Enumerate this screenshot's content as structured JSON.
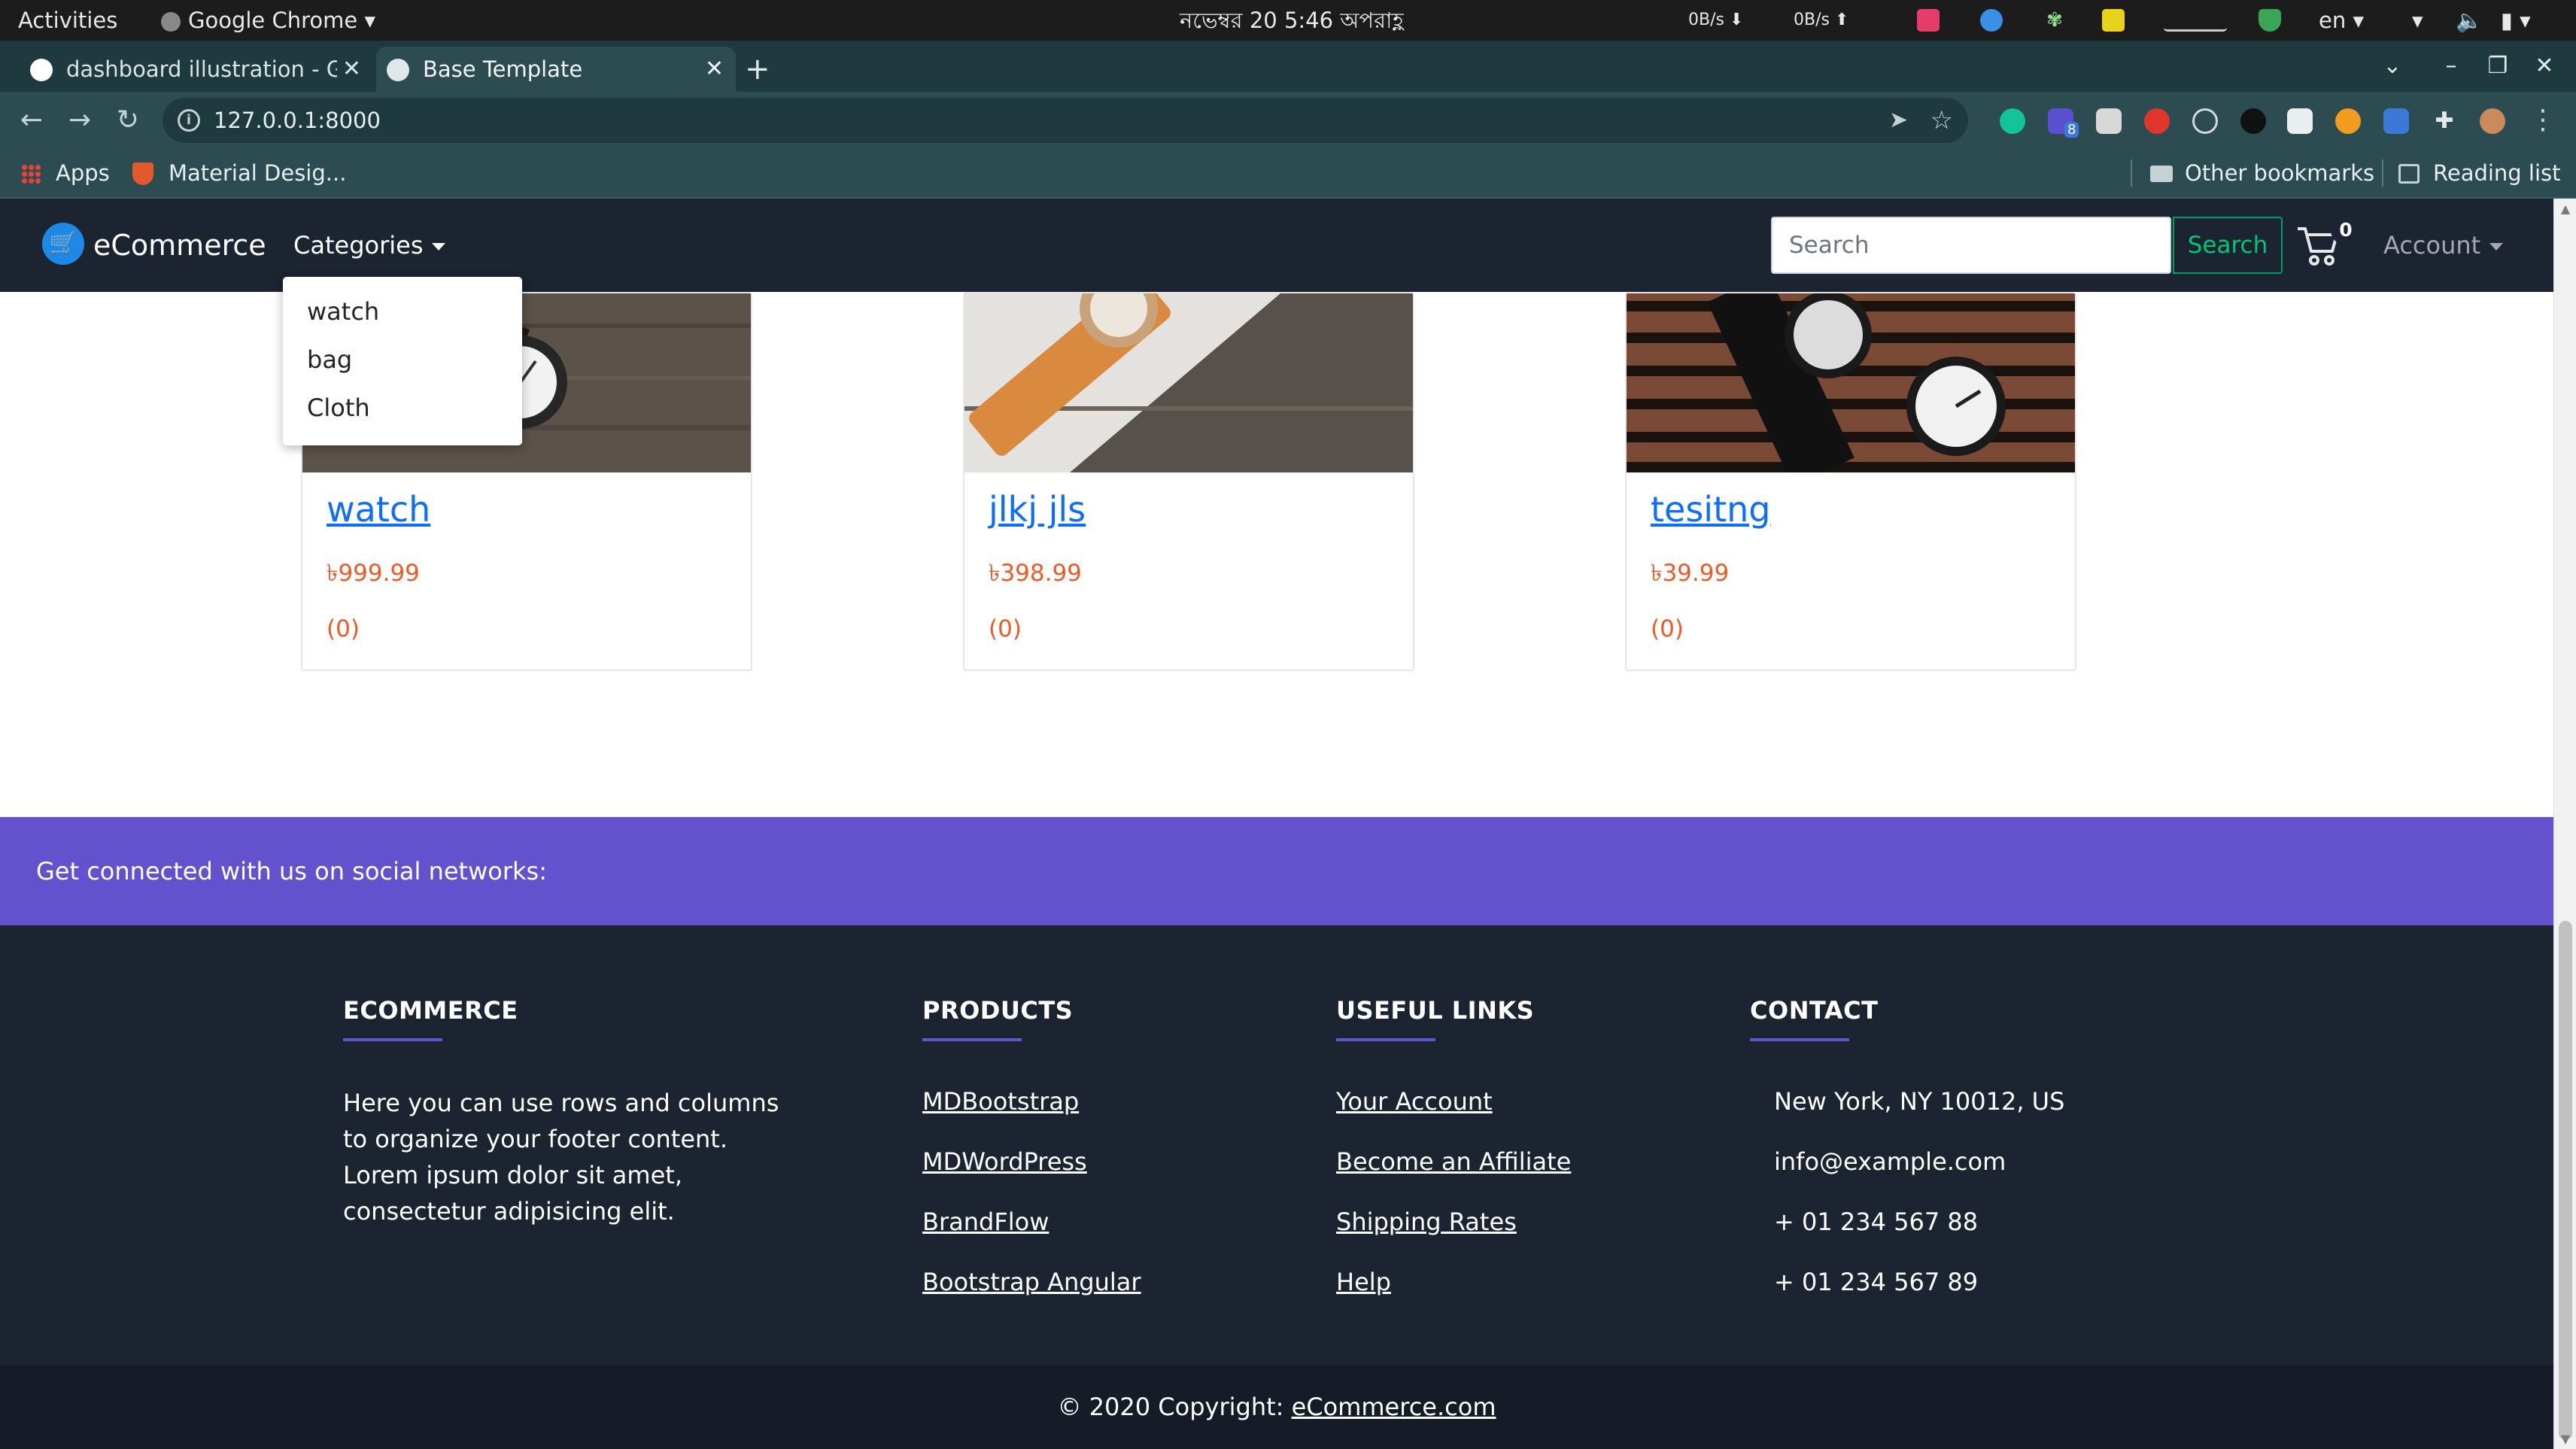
{
  "os": {
    "activities": "Activities",
    "app_name": "Google Chrome",
    "clock": "নভেম্বর 20  5:46 অপরাহ্ণ",
    "net_down": "0B/s",
    "net_up": "0B/s",
    "language": "en"
  },
  "browser": {
    "tabs": [
      {
        "title": "dashboard illustration - Go",
        "active": false
      },
      {
        "title": "Base Template",
        "active": true
      }
    ],
    "new_tab": "+",
    "url": "127.0.0.1:8000",
    "bookmarks": {
      "apps": "Apps",
      "material": "Material Desig...",
      "other": "Other bookmarks",
      "reading_list": "Reading list"
    },
    "extension_badge": "8"
  },
  "navbar": {
    "brand": "eCommerce",
    "categories": "Categories",
    "search_placeholder": "Search",
    "search_button": "Search",
    "cart_count": "0",
    "account": "Account"
  },
  "dropdown": {
    "items": [
      "watch",
      "bag",
      "Cloth"
    ]
  },
  "products": [
    {
      "name": "watch",
      "price": "৳999.99",
      "reviews": "(0)"
    },
    {
      "name": "jlkj jls",
      "price": "৳398.99",
      "reviews": "(0)"
    },
    {
      "name": "tesitng",
      "price": "৳39.99",
      "reviews": "(0)"
    }
  ],
  "social": {
    "text": "Get connected with us on social networks:"
  },
  "footer": {
    "about_heading": "ECOMMERCE",
    "about_text": "Here you can use rows and columns to organize your footer content. Lorem ipsum dolor sit amet, consectetur adipisicing elit.",
    "products_heading": "PRODUCTS",
    "products_links": [
      "MDBootstrap",
      "MDWordPress",
      "BrandFlow",
      "Bootstrap Angular"
    ],
    "useful_heading": "USEFUL LINKS",
    "useful_links": [
      "Your Account",
      "Become an Affiliate",
      "Shipping Rates",
      "Help"
    ],
    "contact_heading": "CONTACT",
    "contact": [
      "New York, NY 10012, US",
      "info@example.com",
      "+ 01 234 567 88",
      "+ 01 234 567 89"
    ],
    "copyright_prefix": "© 2020 Copyright: ",
    "copyright_link": "eCommerce.com"
  },
  "colors": {
    "navbar_bg": "#1c2331",
    "social_bg": "#6351ce",
    "price": "#ee5a24",
    "link": "#0d6efd",
    "search_btn": "#00c875"
  }
}
